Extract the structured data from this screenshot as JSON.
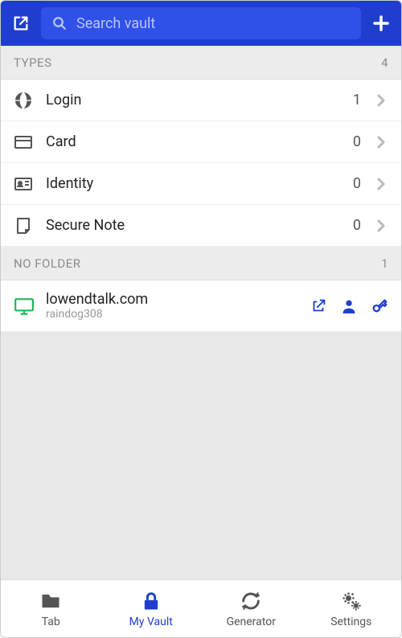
{
  "colors": {
    "brand": "#1f3ecf",
    "brand_light": "#2f51e8",
    "accent_green": "#1db954"
  },
  "header": {
    "search_placeholder": "Search vault"
  },
  "sections": {
    "types": {
      "title": "TYPES",
      "count": "4",
      "items": [
        {
          "label": "Login",
          "count": "1"
        },
        {
          "label": "Card",
          "count": "0"
        },
        {
          "label": "Identity",
          "count": "0"
        },
        {
          "label": "Secure Note",
          "count": "0"
        }
      ]
    },
    "nofolder": {
      "title": "NO FOLDER",
      "count": "1",
      "items": [
        {
          "title": "lowendtalk.com",
          "subtitle": "raindog308"
        }
      ]
    }
  },
  "tabs": [
    {
      "label": "Tab",
      "active": false
    },
    {
      "label": "My Vault",
      "active": true
    },
    {
      "label": "Generator",
      "active": false
    },
    {
      "label": "Settings",
      "active": false
    }
  ]
}
